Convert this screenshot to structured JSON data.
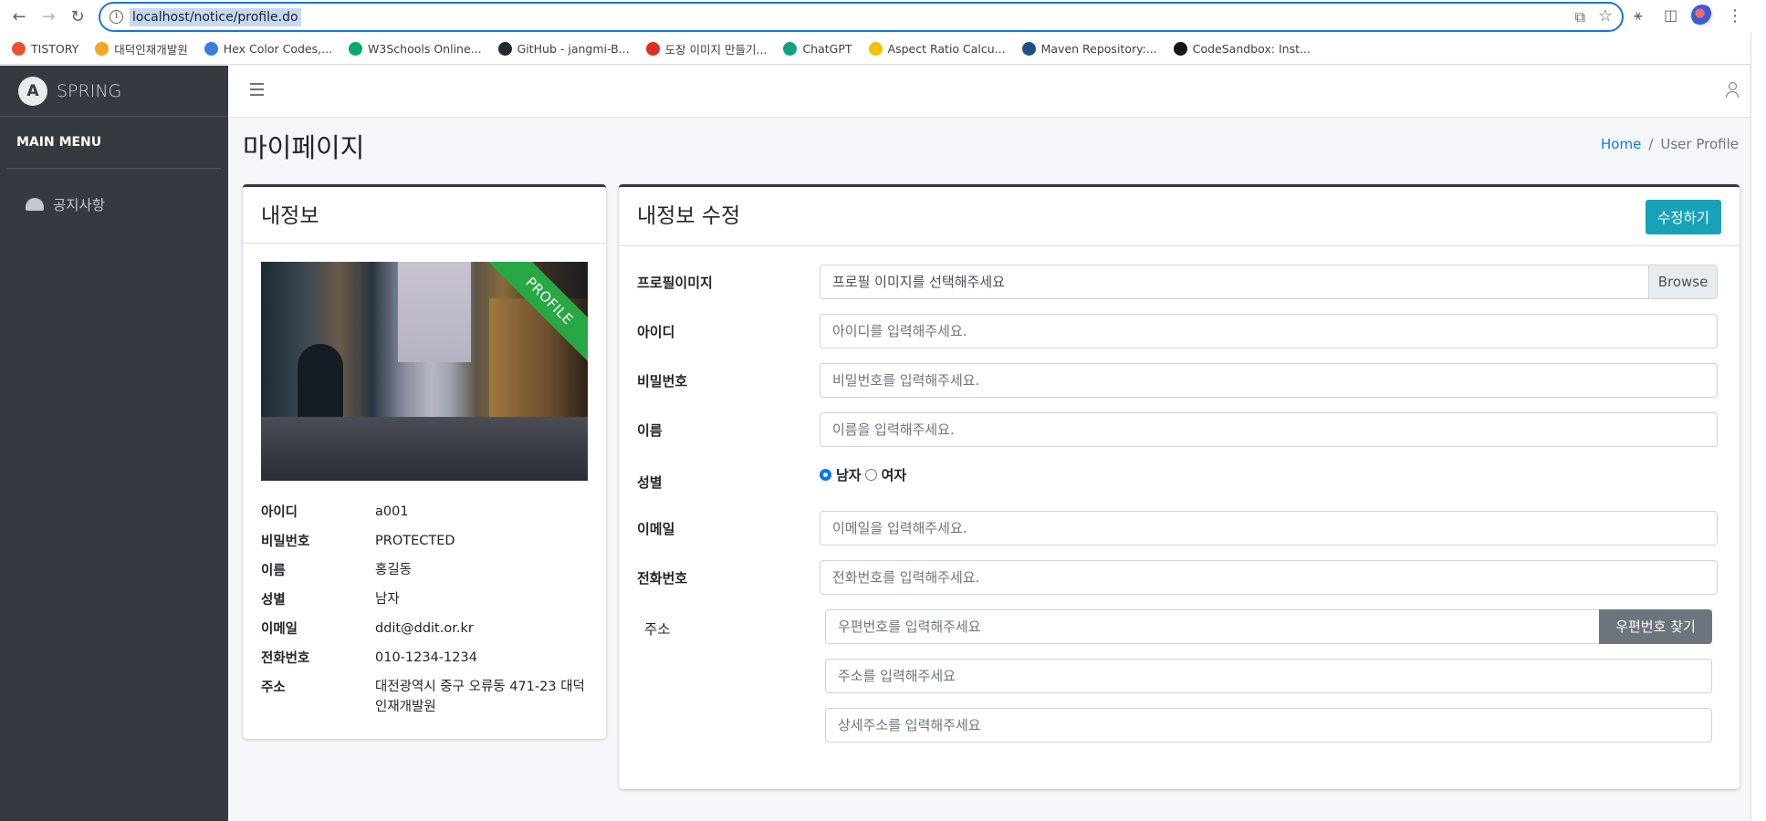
{
  "browser": {
    "url": "localhost/notice/profile.do",
    "bookmarks": [
      {
        "label": "TISTORY",
        "icon": "tistory-icon",
        "color": "#e8542f"
      },
      {
        "label": "대덕인재개발원",
        "icon": "ddit-icon",
        "color": "#f5a623"
      },
      {
        "label": "Hex Color Codes,...",
        "icon": "hex-color-icon",
        "color": "#3b7dd8"
      },
      {
        "label": "W3Schools Online...",
        "icon": "w3schools-icon",
        "color": "#04aa6d"
      },
      {
        "label": "GitHub - jangmi-B...",
        "icon": "github-icon",
        "color": "#24292f"
      },
      {
        "label": "도장 이미지 만들기...",
        "icon": "stamp-icon",
        "color": "#d93025"
      },
      {
        "label": "ChatGPT",
        "icon": "chatgpt-icon",
        "color": "#10a37f"
      },
      {
        "label": "Aspect Ratio Calcu...",
        "icon": "aspect-ratio-icon",
        "color": "#f2c200"
      },
      {
        "label": "Maven Repository:...",
        "icon": "maven-icon",
        "color": "#1f4f8b"
      },
      {
        "label": "CodeSandbox: Inst...",
        "icon": "codesandbox-icon",
        "color": "#151515"
      }
    ]
  },
  "sidebar": {
    "brand": "SPRING",
    "brand_logo": "A",
    "section": "MAIN MENU",
    "items": [
      {
        "label": "공지사항",
        "icon": "dashboard-icon"
      }
    ]
  },
  "header": {
    "title": "마이페이지",
    "breadcrumb": {
      "home": "Home",
      "separator": "/",
      "current": "User Profile"
    }
  },
  "profile_card": {
    "title": "내정보",
    "ribbon": "PROFILE",
    "fields": [
      {
        "label": "아이디",
        "value": "a001"
      },
      {
        "label": "비밀번호",
        "value": "PROTECTED"
      },
      {
        "label": "이름",
        "value": "홍길동"
      },
      {
        "label": "성별",
        "value": "남자"
      },
      {
        "label": "이메일",
        "value": "ddit@ddit.or.kr"
      },
      {
        "label": "전화번호",
        "value": "010-1234-1234"
      },
      {
        "label": "주소",
        "value": "대전광역시 중구 오류동 471-23 대덕인재개발원"
      }
    ]
  },
  "edit_card": {
    "title": "내정보 수정",
    "submit": "수정하기",
    "profile_image": {
      "label": "프로필이미지",
      "value": "프로필 이미지를 선택해주세요",
      "browse": "Browse"
    },
    "id": {
      "label": "아이디",
      "placeholder": "아이디를 입력해주세요."
    },
    "password": {
      "label": "비밀번호",
      "placeholder": "비밀번호를 입력해주세요."
    },
    "name": {
      "label": "이름",
      "placeholder": "이름을 입력해주세요."
    },
    "gender": {
      "label": "성별",
      "options": [
        "남자",
        "여자"
      ],
      "selected": "남자"
    },
    "email": {
      "label": "이메일",
      "placeholder": "이메일을 입력해주세요."
    },
    "phone": {
      "label": "전화번호",
      "placeholder": "전화번호를 입력해주세요."
    },
    "address": {
      "label": "주소",
      "zip_placeholder": "우편번호를 입력해주세요",
      "zip_button": "우편번호 찾기",
      "addr_placeholder": "주소를 입력해주세요",
      "detail_placeholder": "상세주소를 입력해주세요"
    }
  },
  "colors": {
    "sidebar_bg": "#343a40",
    "accent_teal": "#17a2b8",
    "ribbon_green": "#28a745",
    "link_blue": "#007bff"
  }
}
